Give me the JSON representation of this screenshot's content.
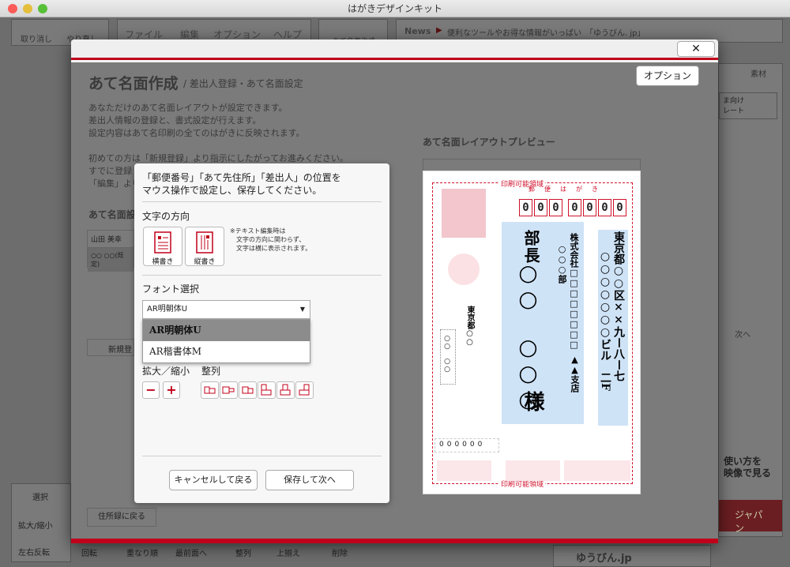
{
  "window": {
    "title": "はがきデザインキット"
  },
  "app": {
    "toolbar": {
      "undo": "取り消し",
      "redo": "やり直し",
      "menu": [
        "ファイル",
        "編集",
        "オプション",
        "ヘルプ"
      ],
      "address_tool": "あて名面作成"
    },
    "news": {
      "label": "News",
      "text": "便利なツールやお得な情報がいっぱい　「ゆうびん. jp」"
    },
    "side": {
      "material": "素材",
      "template": "ま向け\nレート",
      "next": "次へ",
      "video": "使い方を\n映像で見る",
      "japan": "ジャパン",
      "yubin": "ゆうびん.jp"
    },
    "bottom": {
      "select": "選択",
      "zoom": "拡大/縮小",
      "flip": "左右反転",
      "rotate": "回転",
      "order": "重なり順",
      "front": "最前面へ",
      "align": "整列",
      "align_top": "上揃え",
      "delete": "削除",
      "back_to_address": "住所録に戻る"
    }
  },
  "dialog": {
    "close": "✕",
    "option_button": "オプション",
    "title": "あて名面作成",
    "subtitle": "/ 差出人登録・あて名面設定",
    "desc": [
      "あなただけのあて名面レイアウトが設定できます。",
      "差出人情報の登録と、書式設定が行えます。",
      "設定内容はあて名印刷の全てのはがきに反映されます。",
      "",
      "初めての方は「新規登録」より指示にしたがってお進みください。",
      "すでに登録",
      "「編集」より"
    ],
    "section_label": "あて名面設",
    "list": [
      "山田 美幸",
      "○○ ○○(既定)"
    ],
    "new_register": "新規登",
    "preview_label": "あて名面レイアウトプレビュー"
  },
  "popup": {
    "instruction": [
      "「郵便番号」「あて先住所」「差出人」の位置を",
      "マウス操作で設定し、保存してください。"
    ],
    "direction_label": "文字の方向",
    "horizontal": "横書き",
    "vertical": "縦書き",
    "note": [
      "※テキスト編集時は",
      "文字の方向に関わらず、",
      "文字は横に表示されます。"
    ],
    "font_label": "フォント選択",
    "font_selected": "AR明朝体U",
    "font_options": [
      "AR明朝体U",
      "AR楷書体M"
    ],
    "zoom_label": "拡大／縮小",
    "align_label": "整列",
    "minus": "−",
    "plus": "+",
    "cancel": "キャンセルして戻る",
    "save": "保存して次へ"
  },
  "preview": {
    "printable": "印刷可能領域",
    "postal_label": "郵　便　は　が　き",
    "postal": [
      "0",
      "0",
      "0",
      "0",
      "0",
      "0",
      "0"
    ],
    "recipient_title": "部長",
    "recipient_name": "○○　○○○",
    "honorific": "様",
    "company": "株式会社□□□□□□□□",
    "dept": "○○○部",
    "branch": "▲▲支店",
    "address1": "東京都○○区××九ー八ー七",
    "address2": "○○○○○○○ビル　二F",
    "sender_addr": "東京都○○",
    "sender_postal": "000000"
  },
  "colors": {
    "accent": "#c0001a",
    "highlight": "#cfe3f7",
    "pink": "#f2c6cc"
  }
}
